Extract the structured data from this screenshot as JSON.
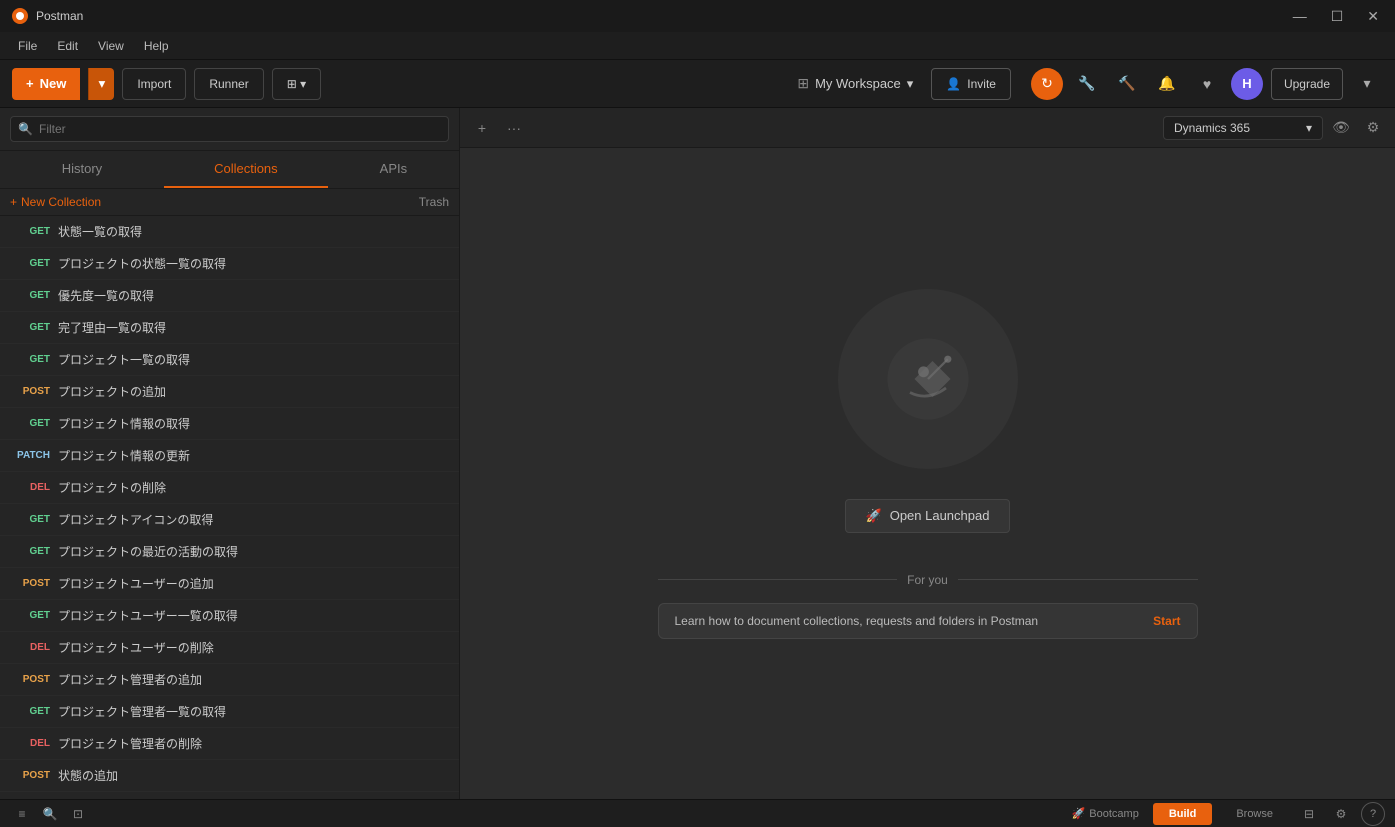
{
  "app": {
    "title": "Postman",
    "window_controls": {
      "minimize": "—",
      "maximize": "☐",
      "close": "✕"
    }
  },
  "menubar": {
    "items": [
      "File",
      "Edit",
      "View",
      "Help"
    ]
  },
  "toolbar": {
    "new_label": "New",
    "import_label": "Import",
    "runner_label": "Runner",
    "workspace_label": "My Workspace",
    "invite_label": "Invite",
    "upgrade_label": "Upgrade",
    "avatar_initials": "H"
  },
  "sidebar": {
    "search_placeholder": "Filter",
    "tabs": [
      "History",
      "Collections",
      "APIs"
    ],
    "active_tab": "Collections",
    "new_collection_label": "New Collection",
    "trash_label": "Trash",
    "requests": [
      {
        "method": "GET",
        "name": "状態一覧の取得"
      },
      {
        "method": "GET",
        "name": "プロジェクトの状態一覧の取得"
      },
      {
        "method": "GET",
        "name": "優先度一覧の取得"
      },
      {
        "method": "GET",
        "name": "完了理由一覧の取得"
      },
      {
        "method": "GET",
        "name": "プロジェクト一覧の取得"
      },
      {
        "method": "POST",
        "name": "プロジェクトの追加"
      },
      {
        "method": "GET",
        "name": "プロジェクト情報の取得"
      },
      {
        "method": "PATCH",
        "name": "プロジェクト情報の更新"
      },
      {
        "method": "DEL",
        "name": "プロジェクトの削除"
      },
      {
        "method": "GET",
        "name": "プロジェクトアイコンの取得"
      },
      {
        "method": "GET",
        "name": "プロジェクトの最近の活動の取得"
      },
      {
        "method": "POST",
        "name": "プロジェクトユーザーの追加"
      },
      {
        "method": "GET",
        "name": "プロジェクトユーザー一覧の取得"
      },
      {
        "method": "DEL",
        "name": "プロジェクトユーザーの削除"
      },
      {
        "method": "POST",
        "name": "プロジェクト管理者の追加"
      },
      {
        "method": "GET",
        "name": "プロジェクト管理者一覧の取得"
      },
      {
        "method": "DEL",
        "name": "プロジェクト管理者の削除"
      },
      {
        "method": "POST",
        "name": "状態の追加"
      }
    ]
  },
  "content": {
    "env_selector_label": "Dynamics 365",
    "empty_state": {
      "open_launchpad_label": "Open Launchpad",
      "for_you_label": "For you",
      "learn_text": "Learn how to document collections, requests and folders in Postman",
      "start_label": "Start"
    }
  },
  "bottombar": {
    "bootcamp_label": "Bootcamp",
    "build_label": "Build",
    "browse_label": "Browse"
  },
  "icons": {
    "search": "🔍",
    "plus": "+",
    "dots": "···",
    "chevron_down": "▾",
    "grid": "⊞",
    "user_plus": "👤+",
    "sync": "↻",
    "wrench": "🔧",
    "bell": "🔔",
    "heart": "♥",
    "eye": "👁",
    "gear": "⚙",
    "launchpad": "🚀",
    "sidebar_toggle": "≡",
    "search_bottom": "🔍",
    "layout": "⊡",
    "settings_bottom": "⚙",
    "help": "?"
  }
}
